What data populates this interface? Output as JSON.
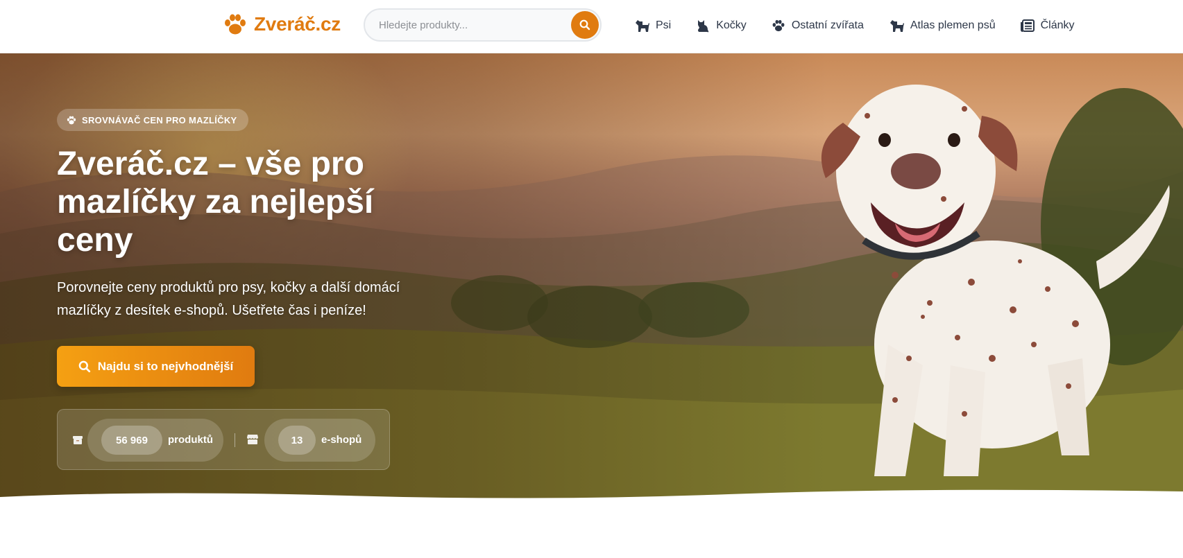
{
  "header": {
    "logo_text": "Zveráč.cz",
    "search_placeholder": "Hledejte produkty...",
    "nav": [
      {
        "label": "Psi",
        "icon": "dog-icon"
      },
      {
        "label": "Kočky",
        "icon": "cat-icon"
      },
      {
        "label": "Ostatní zvířata",
        "icon": "paw-icon"
      },
      {
        "label": "Atlas plemen psů",
        "icon": "dog-icon"
      },
      {
        "label": "Články",
        "icon": "newspaper-icon"
      }
    ]
  },
  "hero": {
    "badge": "SROVNÁVAČ CEN PRO MAZLÍČKY",
    "title": "Zveráč.cz – vše pro mazlíčky za nejlepší ceny",
    "subtitle": "Porovnejte ceny produktů pro psy, kočky a další domácí mazlíčky z desítek e-shopů. Ušetřete čas i peníze!",
    "cta_label": "Najdu si to nejvhodnější",
    "stats": [
      {
        "value": "56 969",
        "label": "produktů",
        "icon": "box-icon"
      },
      {
        "value": "13",
        "label": "e-shopů",
        "icon": "store-icon"
      }
    ]
  },
  "colors": {
    "brand": "#e07b10",
    "cta_start": "#f5a012",
    "cta_end": "#e07b10",
    "nav_text": "#2d3748"
  }
}
